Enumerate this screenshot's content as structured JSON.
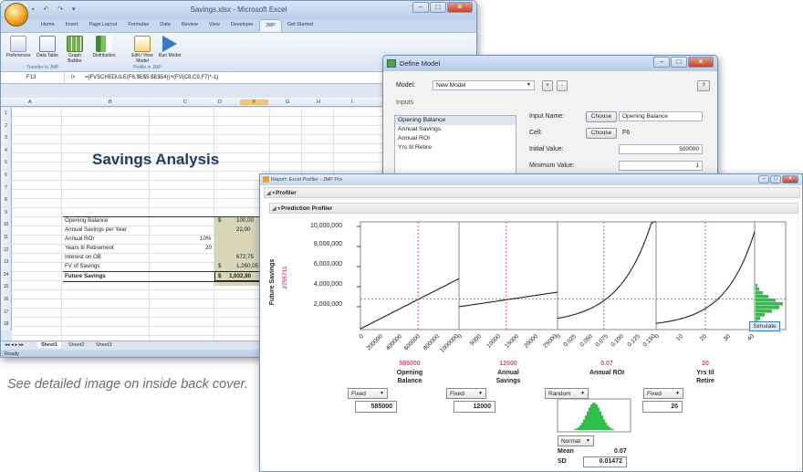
{
  "excel": {
    "title": "Savings.xlsx - Microsoft Excel",
    "tabs": [
      "Home",
      "Insert",
      "Page Layout",
      "Formulas",
      "Data",
      "Review",
      "View",
      "Developer",
      "JMP",
      "Get Started"
    ],
    "active_tab": "JMP",
    "ribbon_items": [
      "Preferences",
      "Data Table",
      "Graph Builder",
      "Distribution",
      "Edit / View Model",
      "Run Model"
    ],
    "ribbon_groups": [
      "Transfer to JMP",
      "Profile in JMP"
    ],
    "name_box": "F13",
    "formula": "=(FVSCHEDULE(F6,$E$5:$E$54))+(FV(C8,C9,F7)*-1)",
    "columns": [
      "A",
      "B",
      "C",
      "D",
      "E",
      "F",
      "G",
      "H",
      "I"
    ],
    "rows": [
      "1",
      "2",
      "3",
      "4",
      "5",
      "6",
      "7",
      "8",
      "9",
      "10",
      "11",
      "12",
      "13",
      "14",
      "15",
      "16",
      "17",
      "18"
    ],
    "sheet_title": "Savings Analysis",
    "table": {
      "opening_balance": {
        "label": "Opening Balance",
        "cur": "$",
        "value": "100,00"
      },
      "annual_savings": {
        "label": "Annual Savings per Year",
        "value": "22,00"
      },
      "annual_roi": {
        "label": "Annual ROI",
        "input": "10%"
      },
      "years": {
        "label": "Years til Retirement",
        "input": "20"
      },
      "interest": {
        "label": "Interest on OB",
        "value": "672,75"
      },
      "fv": {
        "label": "FV of Savings",
        "cur": "$",
        "value": "1,260,05"
      },
      "future": {
        "label": "Future Savings",
        "cur": "$",
        "value": "1,932,80"
      }
    },
    "sheet_tabs": [
      "Sheet1",
      "Sheet2",
      "Sheet3"
    ],
    "status": "Ready"
  },
  "define_model": {
    "title": "Define Model",
    "model_label": "Model:",
    "model_value": "New Model",
    "inputs_label": "Inputs",
    "inputs": [
      "Opening Balance",
      "Annual Savings",
      "Annual ROI",
      "Yrs til Retire"
    ],
    "input_name_label": "Input Name:",
    "input_name_value": "Opening Balance",
    "cell_label": "Cell:",
    "cell_value": "F6",
    "choose_label": "Choose",
    "initial_label": "Initial Value:",
    "initial_value": "500000",
    "min_label": "Minimum Value:",
    "min_value": "1",
    "plus": "+",
    "minus": "-",
    "help": "?"
  },
  "profiler": {
    "title": "Report: Excel Profiler - JMP Pro",
    "outline1": "Profiler",
    "outline2": "Prediction Profiler",
    "y_label": "Future Savings",
    "y_current": "2755711",
    "y_ticks": [
      "10,000,000",
      "8,000,000",
      "6,000,000",
      "4,000,000",
      "2,000,000"
    ],
    "factors": [
      {
        "name_lines": [
          "Opening",
          "Balance"
        ],
        "value": "585000",
        "mode": "Fixed",
        "box": "585000",
        "ticks": [
          "0",
          "200000",
          "400000",
          "600000",
          "800000",
          "1000000"
        ]
      },
      {
        "name_lines": [
          "Annual",
          "Savings"
        ],
        "value": "12000",
        "mode": "Fixed",
        "box": "12000",
        "ticks": [
          "0",
          "5000",
          "10000",
          "15000",
          "20000",
          "25000"
        ]
      },
      {
        "name_lines": [
          "Annual ROI"
        ],
        "value": "0.07",
        "mode": "Random",
        "box": "",
        "ticks": [
          "0",
          "0.025",
          "0.050",
          "0.075",
          "0.100",
          "0.125",
          "0.150"
        ]
      },
      {
        "name_lines": [
          "Yrs til",
          "Retire"
        ],
        "value": "20",
        "mode": "Fixed",
        "box": "20",
        "ticks": [
          "0",
          "10",
          "20",
          "30",
          "40"
        ]
      }
    ],
    "random": {
      "dist": "Normal",
      "mean_label": "Mean",
      "mean": "0.07",
      "sd_label": "SD",
      "sd": "0.01472"
    },
    "simulate": "Simulate"
  },
  "caption": "See detailed image on inside back cover."
}
